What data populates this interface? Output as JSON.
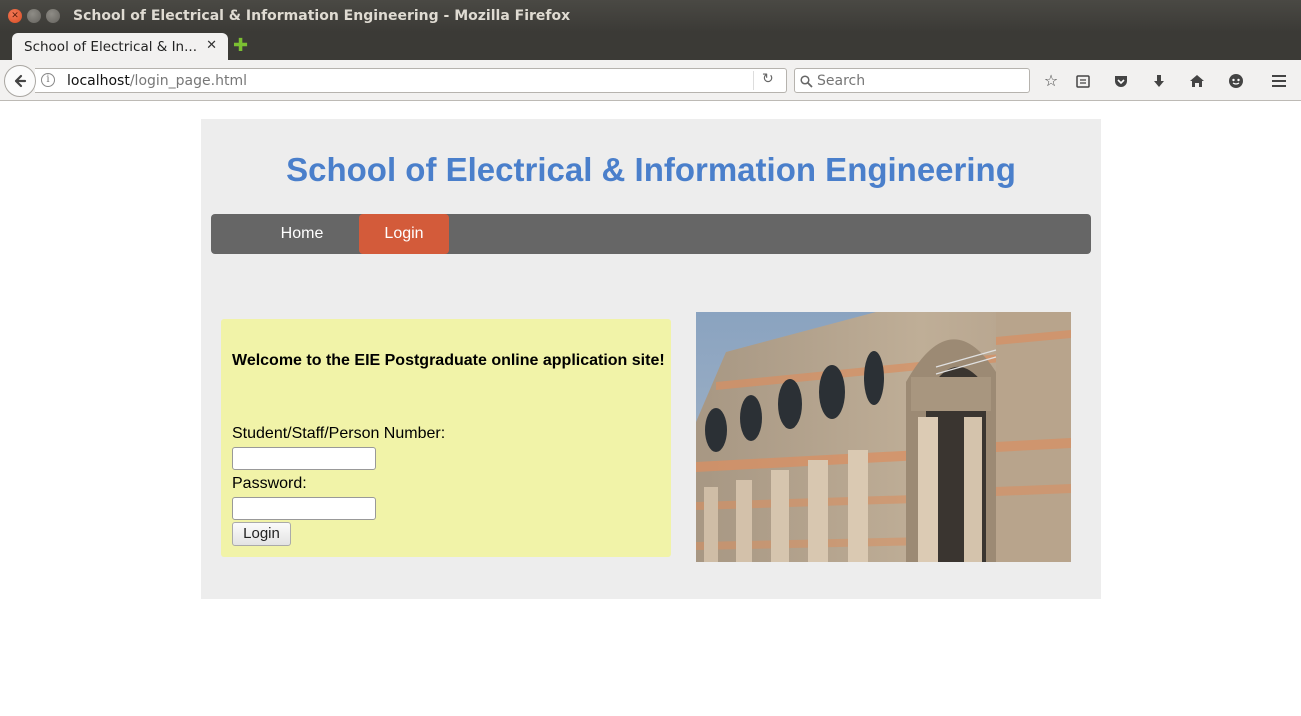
{
  "window": {
    "title": "School of Electrical & Information Engineering - Mozilla Firefox"
  },
  "tabs": [
    {
      "label": "School of Electrical & In...",
      "close_glyph": "✕"
    }
  ],
  "browser": {
    "url_host": "localhost",
    "url_path": "/login_page.html",
    "search_placeholder": "Search",
    "icons": [
      "back-arrow-icon",
      "info-icon",
      "reload-icon",
      "search-icon",
      "bookmark-star-icon",
      "reading-list-icon",
      "pocket-icon",
      "download-icon",
      "home-icon",
      "chat-icon",
      "menu-hamburger-icon"
    ]
  },
  "site": {
    "title": "School of Electrical & Information Engineering",
    "menu": {
      "home": "Home",
      "login": "Login"
    },
    "login_form": {
      "welcome": "Welcome to the EIE Postgraduate online application site!",
      "user_label": "Student/Staff/Person Number:",
      "user_value": "",
      "password_label": "Password:",
      "password_value": "",
      "submit": "Login"
    }
  },
  "colors": {
    "title_blue": "#4a7fcb",
    "menu_bar": "#666666",
    "menu_active": "#d35b3a",
    "login_box": "#f1f3a8",
    "page_bg": "#ededed"
  }
}
